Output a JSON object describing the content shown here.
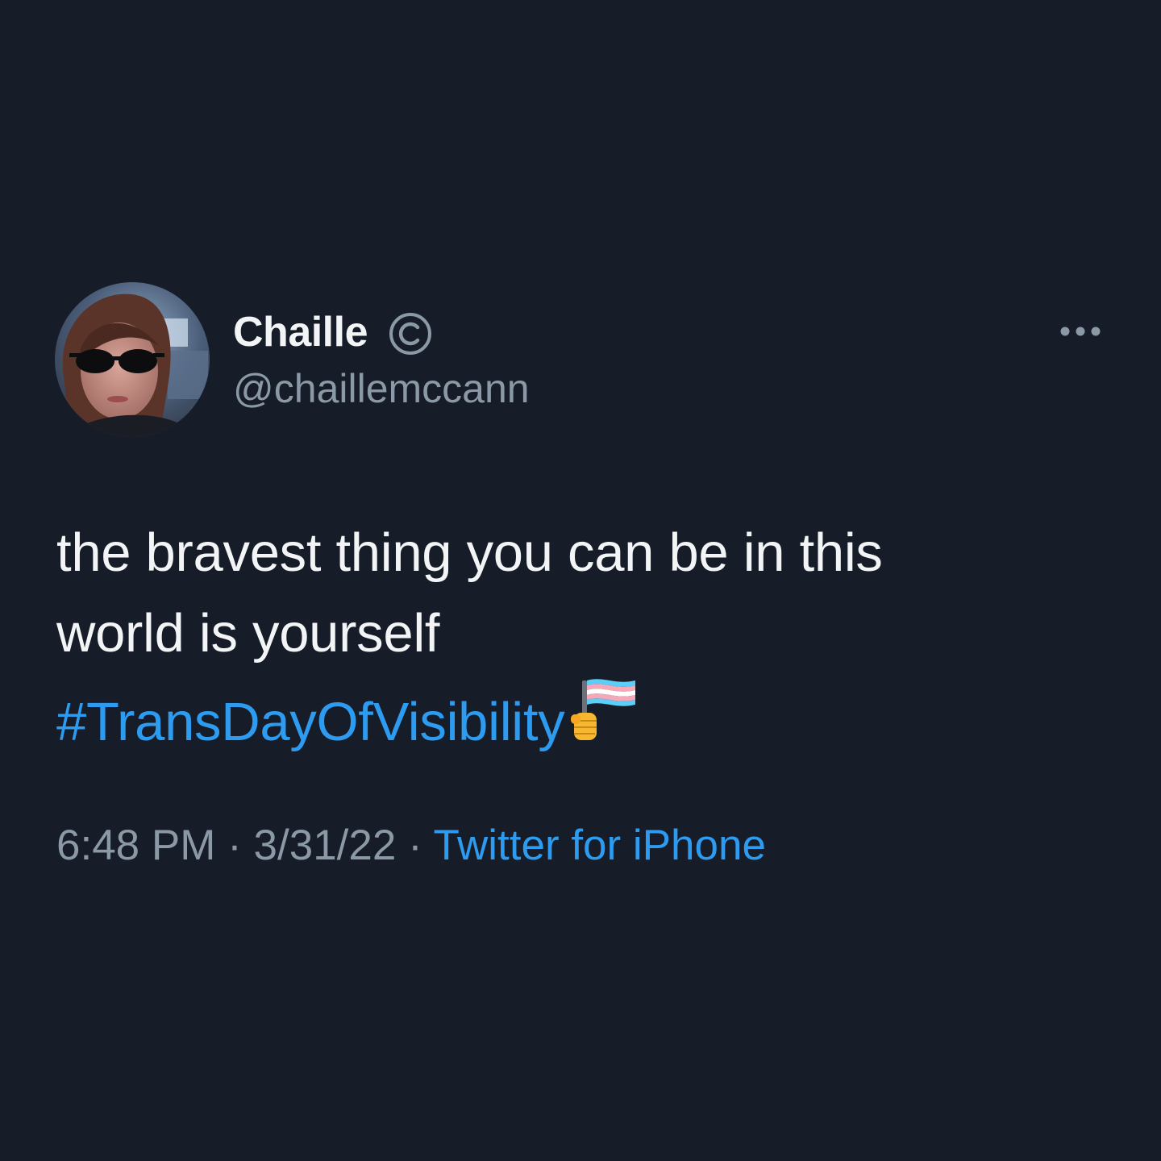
{
  "tweet": {
    "author": {
      "display_name": "Chaille",
      "badge_icon": "copyright-icon",
      "handle": "@chaillemccann"
    },
    "text_lines": [
      "the bravest thing you can be in this",
      "world is yourself"
    ],
    "hashtag": "#TransDayOfVisibility",
    "emoji": "transgender-flag-in-hand-icon",
    "time": "6:48 PM",
    "separator": "·",
    "date": "3/31/22",
    "source": "Twitter for iPhone"
  },
  "colors": {
    "background": "#161d29",
    "primary_text": "#f2f4f5",
    "secondary_text": "#8b98a5",
    "link": "#2d9bf0"
  }
}
